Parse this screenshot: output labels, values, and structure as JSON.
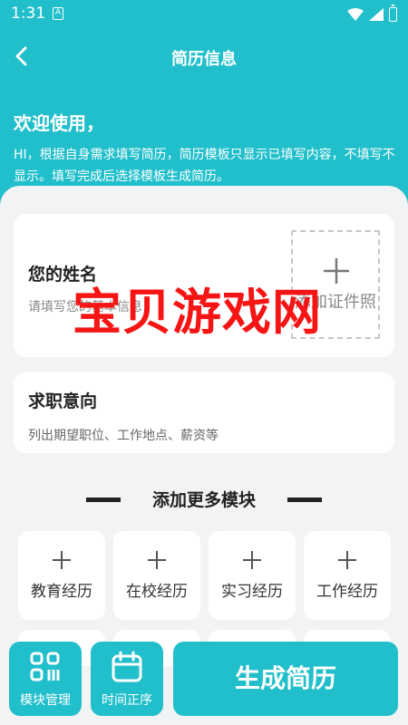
{
  "status_bar": {
    "time": "1:31",
    "app_icon_letter": "A"
  },
  "nav": {
    "title": "简历信息",
    "back_icon": "chevron-left-icon"
  },
  "welcome": {
    "title": "欢迎使用，",
    "desc": "HI，根据自身需求填写简历，简历模板只显示已填写内容，不填写不显示。填写完成后选择模板生成简历。"
  },
  "name_card": {
    "title": "您的姓名",
    "hint": "请填写您的基本信息",
    "photo_label": "添加证件照"
  },
  "job_card": {
    "title": "求职意向",
    "hint": "列出期望职位、工作地点、薪资等"
  },
  "more_section": {
    "title": "添加更多模块",
    "modules": [
      "教育经历",
      "在校经历",
      "实习经历",
      "工作经历"
    ]
  },
  "watermark": "宝贝游戏网",
  "bottom": {
    "module_manage_label": "模块管理",
    "time_order_label": "时间正序",
    "generate_label": "生成简历"
  },
  "colors": {
    "primary": "#21bfcb",
    "watermark": "#f51515"
  }
}
